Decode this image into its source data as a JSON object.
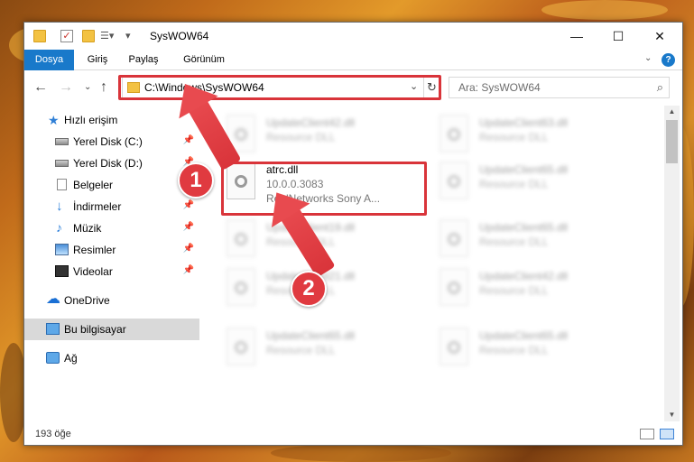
{
  "window": {
    "title": "SysWOW64"
  },
  "ribbon": {
    "tabs": [
      "Dosya",
      "Giriş",
      "Paylaş",
      "Görünüm"
    ],
    "help": "?"
  },
  "address": {
    "path": "C:\\Windows\\SysWOW64",
    "search_placeholder": "Ara: SysWOW64"
  },
  "sidebar": {
    "items": [
      {
        "label": "Hızlı erişim"
      },
      {
        "label": "Yerel Disk (C:)"
      },
      {
        "label": "Yerel Disk (D:)"
      },
      {
        "label": "Belgeler"
      },
      {
        "label": "İndirmeler"
      },
      {
        "label": "Müzik"
      },
      {
        "label": "Resimler"
      },
      {
        "label": "Videolar"
      },
      {
        "label": "OneDrive"
      },
      {
        "label": "Bu bilgisayar"
      },
      {
        "label": "Ağ"
      }
    ]
  },
  "files": {
    "highlighted": {
      "name": "atrc.dll",
      "version": "10.0.0.3083",
      "company": "RealNetworks Sony A..."
    },
    "background": [
      {
        "name": "UpdateClient42.dll",
        "desc": "Resource DLL"
      },
      {
        "name": "UpdateClient63.dll",
        "desc": "Resource DLL"
      },
      {
        "name": "UpdateClient65.dll",
        "desc": "Resource DLL"
      },
      {
        "name": "UpdateClient19.dll",
        "desc": "Resource DLL"
      },
      {
        "name": "UpdateClient65.dll",
        "desc": "Resource DLL"
      },
      {
        "name": "UpdateClient21.dll",
        "desc": "Resource DLL"
      },
      {
        "name": "UpdateClient42.dll",
        "desc": "Resource DLL"
      },
      {
        "name": "UpdateClient65.dll",
        "desc": "Resource DLL"
      },
      {
        "name": "UpdateClient65.dll",
        "desc": "Resource DLL"
      }
    ]
  },
  "status": {
    "count": "193 öğe"
  },
  "callouts": [
    "1",
    "2"
  ],
  "colors": {
    "accent": "#1979ca",
    "highlight": "#d9343a",
    "selected_nav": "#d9d9d9"
  }
}
